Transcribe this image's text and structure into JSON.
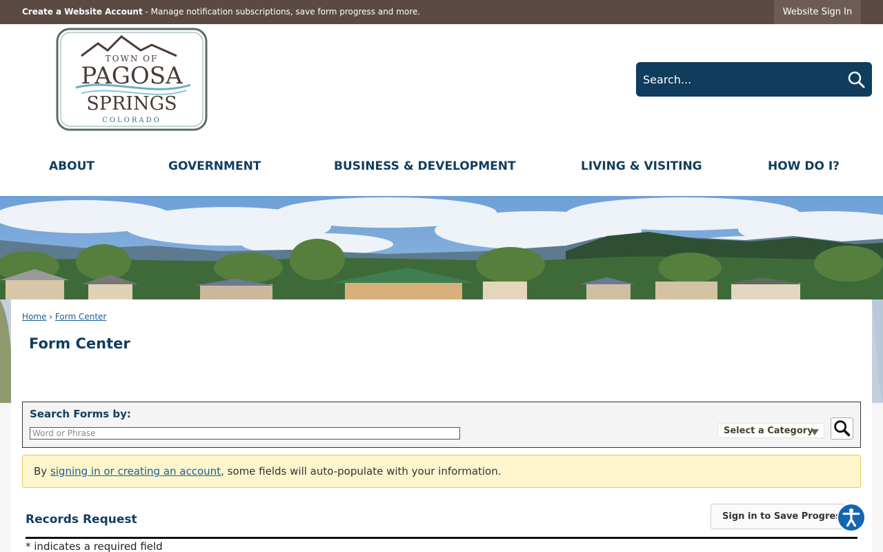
{
  "topbar": {
    "create_account": "Create a Website Account",
    "create_account_desc": " - Manage notification subscriptions, save form progress and more.",
    "sign_in": "Website Sign In"
  },
  "logo": {
    "line1": "TOWN OF",
    "line2": "PAGOSA",
    "line3": "SPRINGS",
    "line4": "COLORADO"
  },
  "search": {
    "placeholder": "Search..."
  },
  "nav": {
    "items": [
      "ABOUT",
      "GOVERNMENT",
      "BUSINESS & DEVELOPMENT",
      "LIVING & VISITING",
      "HOW DO I?"
    ]
  },
  "breadcrumb": {
    "home": "Home",
    "separator": "›",
    "current": "Form Center"
  },
  "page_title": "Form Center",
  "form_search": {
    "label": "Search Forms by:",
    "placeholder": "Word or Phrase",
    "category": "Select a Category"
  },
  "notice": {
    "prefix": "By ",
    "link": "signing in or creating an account",
    "suffix": ", some fields will auto-populate with your information."
  },
  "form": {
    "title": "Records Request",
    "save_button": "Sign in to Save Progress",
    "required_note": "* indicates a required field"
  },
  "colors": {
    "topbar": "#5b4a44",
    "navy": "#103d5e",
    "link": "#1a5d92",
    "notice_bg": "#fdf6cc",
    "accessibility": "#1466b0"
  },
  "icons": {
    "search": "search-icon",
    "category_arrow": "chevron-down-icon",
    "form_search": "search-icon",
    "accessibility": "accessibility-icon"
  }
}
